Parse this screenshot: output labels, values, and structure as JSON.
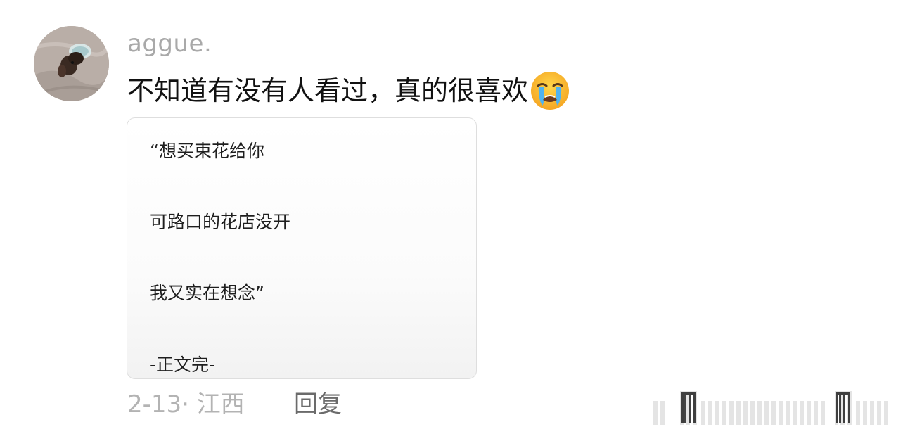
{
  "comment": {
    "username": "aggue.",
    "text": "不知道有没有人看过，真的很喜欢",
    "emoji": "loudly-crying-face",
    "quote_lines": [
      "“想买束花给你",
      "可路口的花店没开",
      "我又实在想念”",
      "-正文完-"
    ],
    "date": "2-13",
    "separator": "·",
    "location": "江西",
    "reply_label": "回复"
  },
  "colors": {
    "username": "#a9a9a9",
    "text": "#111111",
    "meta": "#b3b3b3",
    "reply": "#6b6b6b",
    "card_border": "#dedede"
  }
}
